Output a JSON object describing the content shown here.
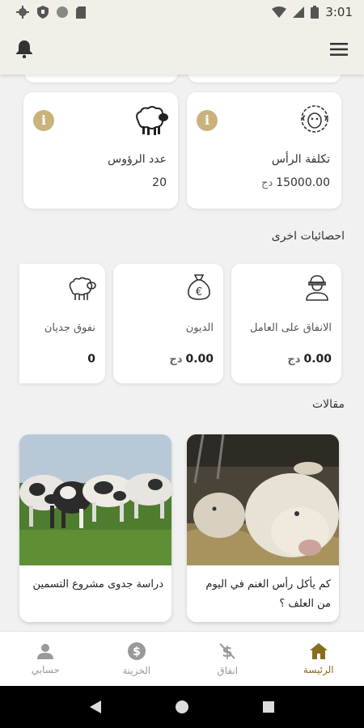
{
  "status_bar": {
    "time": "3:01"
  },
  "colors": {
    "accent": "#8a6d1c",
    "info_badge": "#c9b27c",
    "background": "#f1f1f1"
  },
  "top_stats": [
    {
      "label": "تكلفة الرأس",
      "value": "15000.00",
      "unit": "دج",
      "icon": "sheep-face-icon"
    },
    {
      "label": "عدد الرؤوس",
      "value": "20",
      "unit": "",
      "icon": "sheep-icon"
    }
  ],
  "other_stats": {
    "title": "احصائيات اخرى",
    "items": [
      {
        "label": "الانفاق على العامل",
        "value": "0.00",
        "unit": "دج",
        "icon": "worker-icon"
      },
      {
        "label": "الديون",
        "value": "0.00",
        "unit": "دج",
        "icon": "money-bag-icon"
      },
      {
        "label": "نفوق جديان",
        "value": "0",
        "unit": "",
        "icon": "sheep-icon"
      }
    ]
  },
  "articles": {
    "title": "مقالات",
    "items": [
      {
        "title": "كم يأكل رأس الغنم في اليوم من العلف ؟"
      },
      {
        "title": "دراسة جدوى مشروع التسمين"
      }
    ]
  },
  "bottom_nav": [
    {
      "label": "الرئيسة",
      "icon": "home-icon",
      "active": true
    },
    {
      "label": "انفاق",
      "icon": "expense-icon",
      "active": false
    },
    {
      "label": "الخزينة",
      "icon": "treasury-icon",
      "active": false
    },
    {
      "label": "حسابي",
      "icon": "person-icon",
      "active": false
    }
  ]
}
